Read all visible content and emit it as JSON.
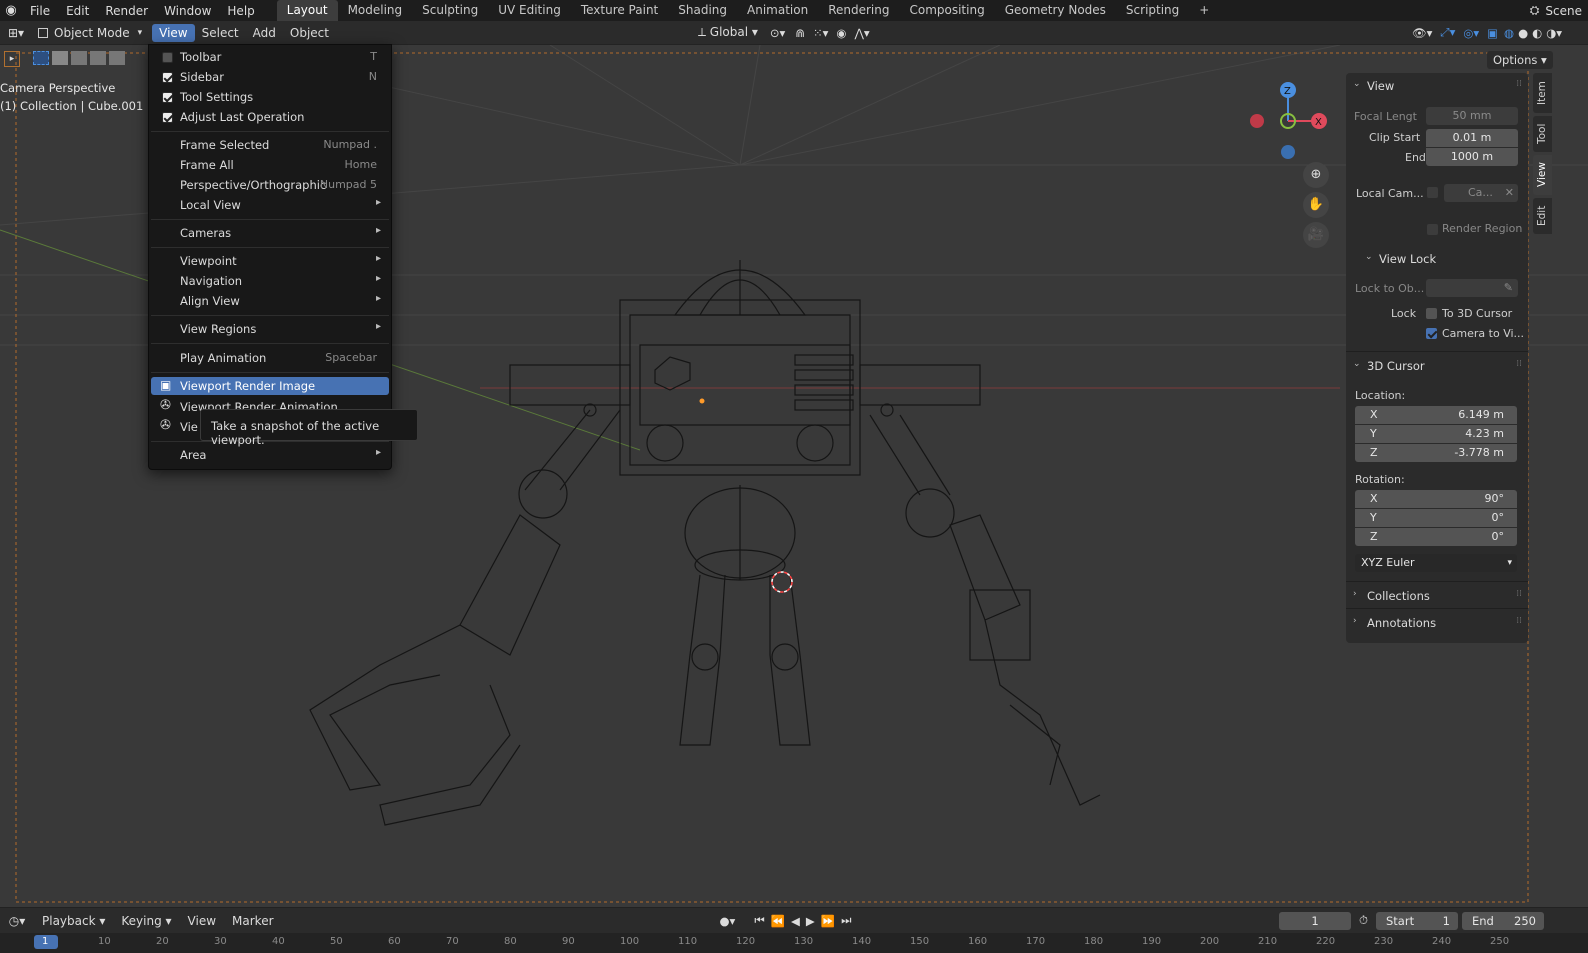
{
  "topbar": {
    "menus": [
      "File",
      "Edit",
      "Render",
      "Window",
      "Help"
    ],
    "workspaces": [
      "Layout",
      "Modeling",
      "Sculpting",
      "UV Editing",
      "Texture Paint",
      "Shading",
      "Animation",
      "Rendering",
      "Compositing",
      "Geometry Nodes",
      "Scripting"
    ],
    "active_workspace": "Layout",
    "scene": "Scene"
  },
  "header": {
    "mode": "Object Mode",
    "menus": [
      "View",
      "Select",
      "Add",
      "Object"
    ],
    "transform_orientation": "Global",
    "options": "Options"
  },
  "viewport": {
    "view_name": "Camera Perspective",
    "collection_info": "(1) Collection | Cube.001",
    "gizmo": {
      "z": "Z",
      "x": "X"
    }
  },
  "view_menu": {
    "checks": [
      {
        "label": "Toolbar",
        "shortcut": "T",
        "checked": false
      },
      {
        "label": "Sidebar",
        "shortcut": "N",
        "checked": true
      },
      {
        "label": "Tool Settings",
        "shortcut": "",
        "checked": true
      },
      {
        "label": "Adjust Last Operation",
        "shortcut": "",
        "checked": true
      }
    ],
    "items": [
      {
        "label": "Frame Selected",
        "shortcut": "Numpad ."
      },
      {
        "label": "Frame All",
        "shortcut": "Home"
      },
      {
        "label": "Perspective/Orthographic",
        "shortcut": "Numpad 5"
      },
      {
        "label": "Local View",
        "shortcut": ""
      },
      {
        "label": "Cameras",
        "shortcut": ""
      },
      {
        "label": "Viewpoint",
        "shortcut": ""
      },
      {
        "label": "Navigation",
        "shortcut": ""
      },
      {
        "label": "Align View",
        "shortcut": ""
      },
      {
        "label": "View Regions",
        "shortcut": ""
      },
      {
        "label": "Play Animation",
        "shortcut": "Spacebar"
      },
      {
        "label": "Viewport Render Image",
        "shortcut": ""
      },
      {
        "label": "Viewport Render Animation",
        "shortcut": ""
      },
      {
        "label": "Vie",
        "shortcut": ""
      },
      {
        "label": "Area",
        "shortcut": ""
      }
    ],
    "tooltip": "Take a snapshot of the active viewport."
  },
  "sidebar": {
    "tabs": [
      "Item",
      "Tool",
      "View",
      "Edit"
    ],
    "view": {
      "title": "View",
      "focal_length_label": "Focal Lengt",
      "focal_length": "50 mm",
      "clip_start_label": "Clip Start",
      "clip_start": "0.01 m",
      "end_label": "End",
      "end": "1000 m",
      "local_camera_label": "Local Cam...",
      "local_camera_value": "Ca...",
      "render_region": "Render Region"
    },
    "view_lock": {
      "title": "View Lock",
      "lock_to_object": "Lock to Ob...",
      "lock_label": "Lock",
      "to_3d_cursor": "To 3D Cursor",
      "camera_to_view": "Camera to Vi..."
    },
    "cursor": {
      "title": "3D Cursor",
      "location_label": "Location:",
      "location": {
        "x": "6.149 m",
        "y": "4.23 m",
        "z": "-3.778 m"
      },
      "rotation_label": "Rotation:",
      "rotation": {
        "x": "90°",
        "y": "0°",
        "z": "0°"
      },
      "rotation_mode": "XYZ Euler",
      "axes": {
        "x": "X",
        "y": "Y",
        "z": "Z"
      }
    },
    "collections": "Collections",
    "annotations": "Annotations"
  },
  "timeline": {
    "menus": [
      "Playback",
      "Keying",
      "View",
      "Marker"
    ],
    "current_frame": "1",
    "start_label": "Start",
    "start": "1",
    "end_label": "End",
    "end": "250"
  },
  "ruler": {
    "ticks": [
      "1",
      "10",
      "20",
      "30",
      "40",
      "50",
      "60",
      "70",
      "80",
      "90",
      "100",
      "110",
      "120",
      "130",
      "140",
      "150",
      "160",
      "170",
      "180",
      "190",
      "200",
      "210",
      "220",
      "230",
      "240",
      "250"
    ]
  }
}
